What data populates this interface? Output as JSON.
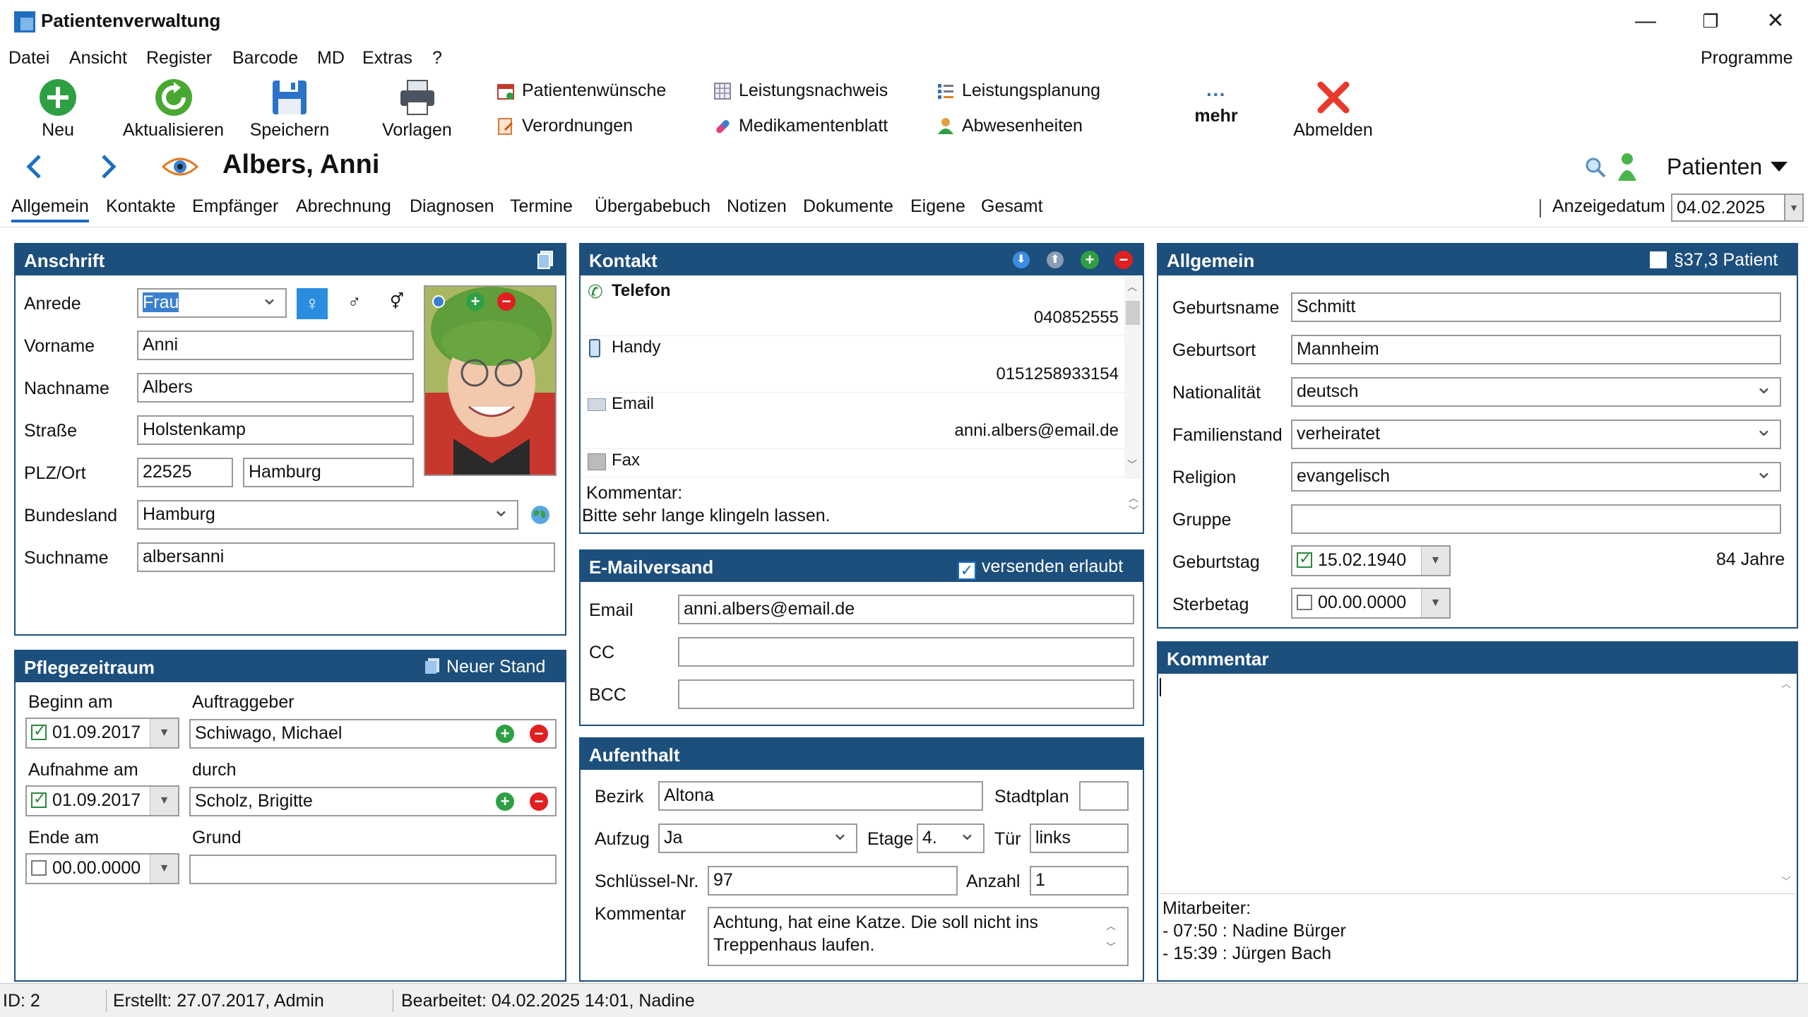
{
  "window": {
    "title": "Patientenverwaltung",
    "minimize": "—",
    "restore": "❐",
    "close": "✕"
  },
  "menu": {
    "items": [
      "Datei",
      "Ansicht",
      "Register",
      "Barcode",
      "MD",
      "Extras",
      "?"
    ],
    "right": "Programme"
  },
  "toolbar": {
    "neu": "Neu",
    "aktualisieren": "Aktualisieren",
    "speichern": "Speichern",
    "vorlagen": "Vorlagen",
    "patientenwuensche": "Patientenwünsche",
    "verordnungen": "Verordnungen",
    "leistungsnachweis": "Leistungsnachweis",
    "medikamentenblatt": "Medikamentenblatt",
    "leistungsplanung": "Leistungsplanung",
    "abwesenheiten": "Abwesenheiten",
    "mehr": "mehr",
    "mehr_dots": "···",
    "abmelden": "Abmelden"
  },
  "nav": {
    "patient_name": "Albers, Anni",
    "patienten": "Patienten"
  },
  "tabs": [
    "Allgemein",
    "Kontakte",
    "Empfänger",
    "Abrechnung",
    "Diagnosen",
    "Termine",
    "Übergabebuch",
    "Notizen",
    "Dokumente",
    "Eigene",
    "Gesamt"
  ],
  "anzeigedatum": {
    "label": "Anzeigedatum",
    "value": "04.02.2025"
  },
  "anschrift": {
    "title": "Anschrift",
    "anrede_label": "Anrede",
    "anrede": "Frau",
    "vorname_label": "Vorname",
    "vorname": "Anni",
    "nachname_label": "Nachname",
    "nachname": "Albers",
    "strasse_label": "Straße",
    "strasse": "Holstenkamp",
    "plzort_label": "PLZ/Ort",
    "plz": "22525",
    "ort": "Hamburg",
    "bundesland_label": "Bundesland",
    "bundesland": "Hamburg",
    "suchname_label": "Suchname",
    "suchname": "albersanni"
  },
  "pflegezeitraum": {
    "title": "Pflegezeitraum",
    "neuer_stand": "Neuer Stand",
    "beginn_label": "Beginn am",
    "beginn": "01.09.2017",
    "auftraggeber_label": "Auftraggeber",
    "auftraggeber": "Schiwago, Michael",
    "aufnahme_label": "Aufnahme am",
    "aufnahme": "01.09.2017",
    "durch_label": "durch",
    "durch": "Scholz, Brigitte",
    "ende_label": "Ende am",
    "ende": "00.00.0000",
    "grund_label": "Grund",
    "grund": ""
  },
  "kontakt": {
    "title": "Kontakt",
    "items": [
      {
        "label": "Telefon",
        "value": "040852555"
      },
      {
        "label": "Handy",
        "value": "0151258933154"
      },
      {
        "label": "Email",
        "value": "anni.albers@email.de"
      },
      {
        "label": "Fax",
        "value": ""
      }
    ],
    "kommentar_label": "Kommentar:",
    "kommentar": "Bitte sehr lange klingeln lassen."
  },
  "emailversand": {
    "title": "E-Mailversand",
    "versenden": "versenden erlaubt",
    "email_label": "Email",
    "email": "anni.albers@email.de",
    "cc_label": "CC",
    "cc": "",
    "bcc_label": "BCC",
    "bcc": ""
  },
  "aufenthalt": {
    "title": "Aufenthalt",
    "bezirk_label": "Bezirk",
    "bezirk": "Altona",
    "stadtplan_label": "Stadtplan",
    "stadtplan": "",
    "aufzug_label": "Aufzug",
    "aufzug": "Ja",
    "etage_label": "Etage",
    "etage": "4.",
    "tuer_label": "Tür",
    "tuer": "links",
    "schluessel_label": "Schlüssel-Nr.",
    "schluessel": "97",
    "anzahl_label": "Anzahl",
    "anzahl": "1",
    "kommentar_label": "Kommentar",
    "kommentar": "Achtung, hat eine Katze. Die soll nicht ins Treppenhaus laufen."
  },
  "allgemein": {
    "title": "Allgemein",
    "p37": "§37,3 Patient",
    "geburtsname_label": "Geburtsname",
    "geburtsname": "Schmitt",
    "geburtsort_label": "Geburtsort",
    "geburtsort": "Mannheim",
    "nationalitaet_label": "Nationalität",
    "nationalitaet": "deutsch",
    "familienstand_label": "Familienstand",
    "familienstand": "verheiratet",
    "religion_label": "Religion",
    "religion": "evangelisch",
    "gruppe_label": "Gruppe",
    "gruppe": "",
    "geburtstag_label": "Geburtstag",
    "geburtstag": "15.02.1940",
    "alter": "84 Jahre",
    "sterbetag_label": "Sterbetag",
    "sterbetag": "00.00.0000"
  },
  "kommentar": {
    "title": "Kommentar",
    "mitarbeiter_label": "Mitarbeiter:",
    "entries": [
      "- 07:50 : Nadine Bürger",
      "- 15:39 : Jürgen Bach"
    ]
  },
  "status": {
    "id": "ID: 2",
    "erstellt": "Erstellt: 27.07.2017, Admin",
    "bearbeitet": "Bearbeitet: 04.02.2025 14:01, Nadine"
  },
  "colors": {
    "panel_header": "#1d4f7d",
    "accent": "#1b6ec2",
    "green": "#2ea043",
    "red": "#e02020"
  },
  "icons": [
    "plus-circle-icon",
    "refresh-icon",
    "floppy-disk-icon",
    "printer-icon",
    "calendar-icon",
    "document-edit-icon",
    "grid-table-icon",
    "pill-icon",
    "list-plan-icon",
    "person-icon",
    "ellipsis-icon",
    "x-icon",
    "arrow-left-icon",
    "arrow-right-icon",
    "eye-icon",
    "search-icon",
    "user-icon",
    "globe-icon",
    "phone-icon",
    "mobile-icon",
    "mail-icon",
    "fax-icon"
  ]
}
